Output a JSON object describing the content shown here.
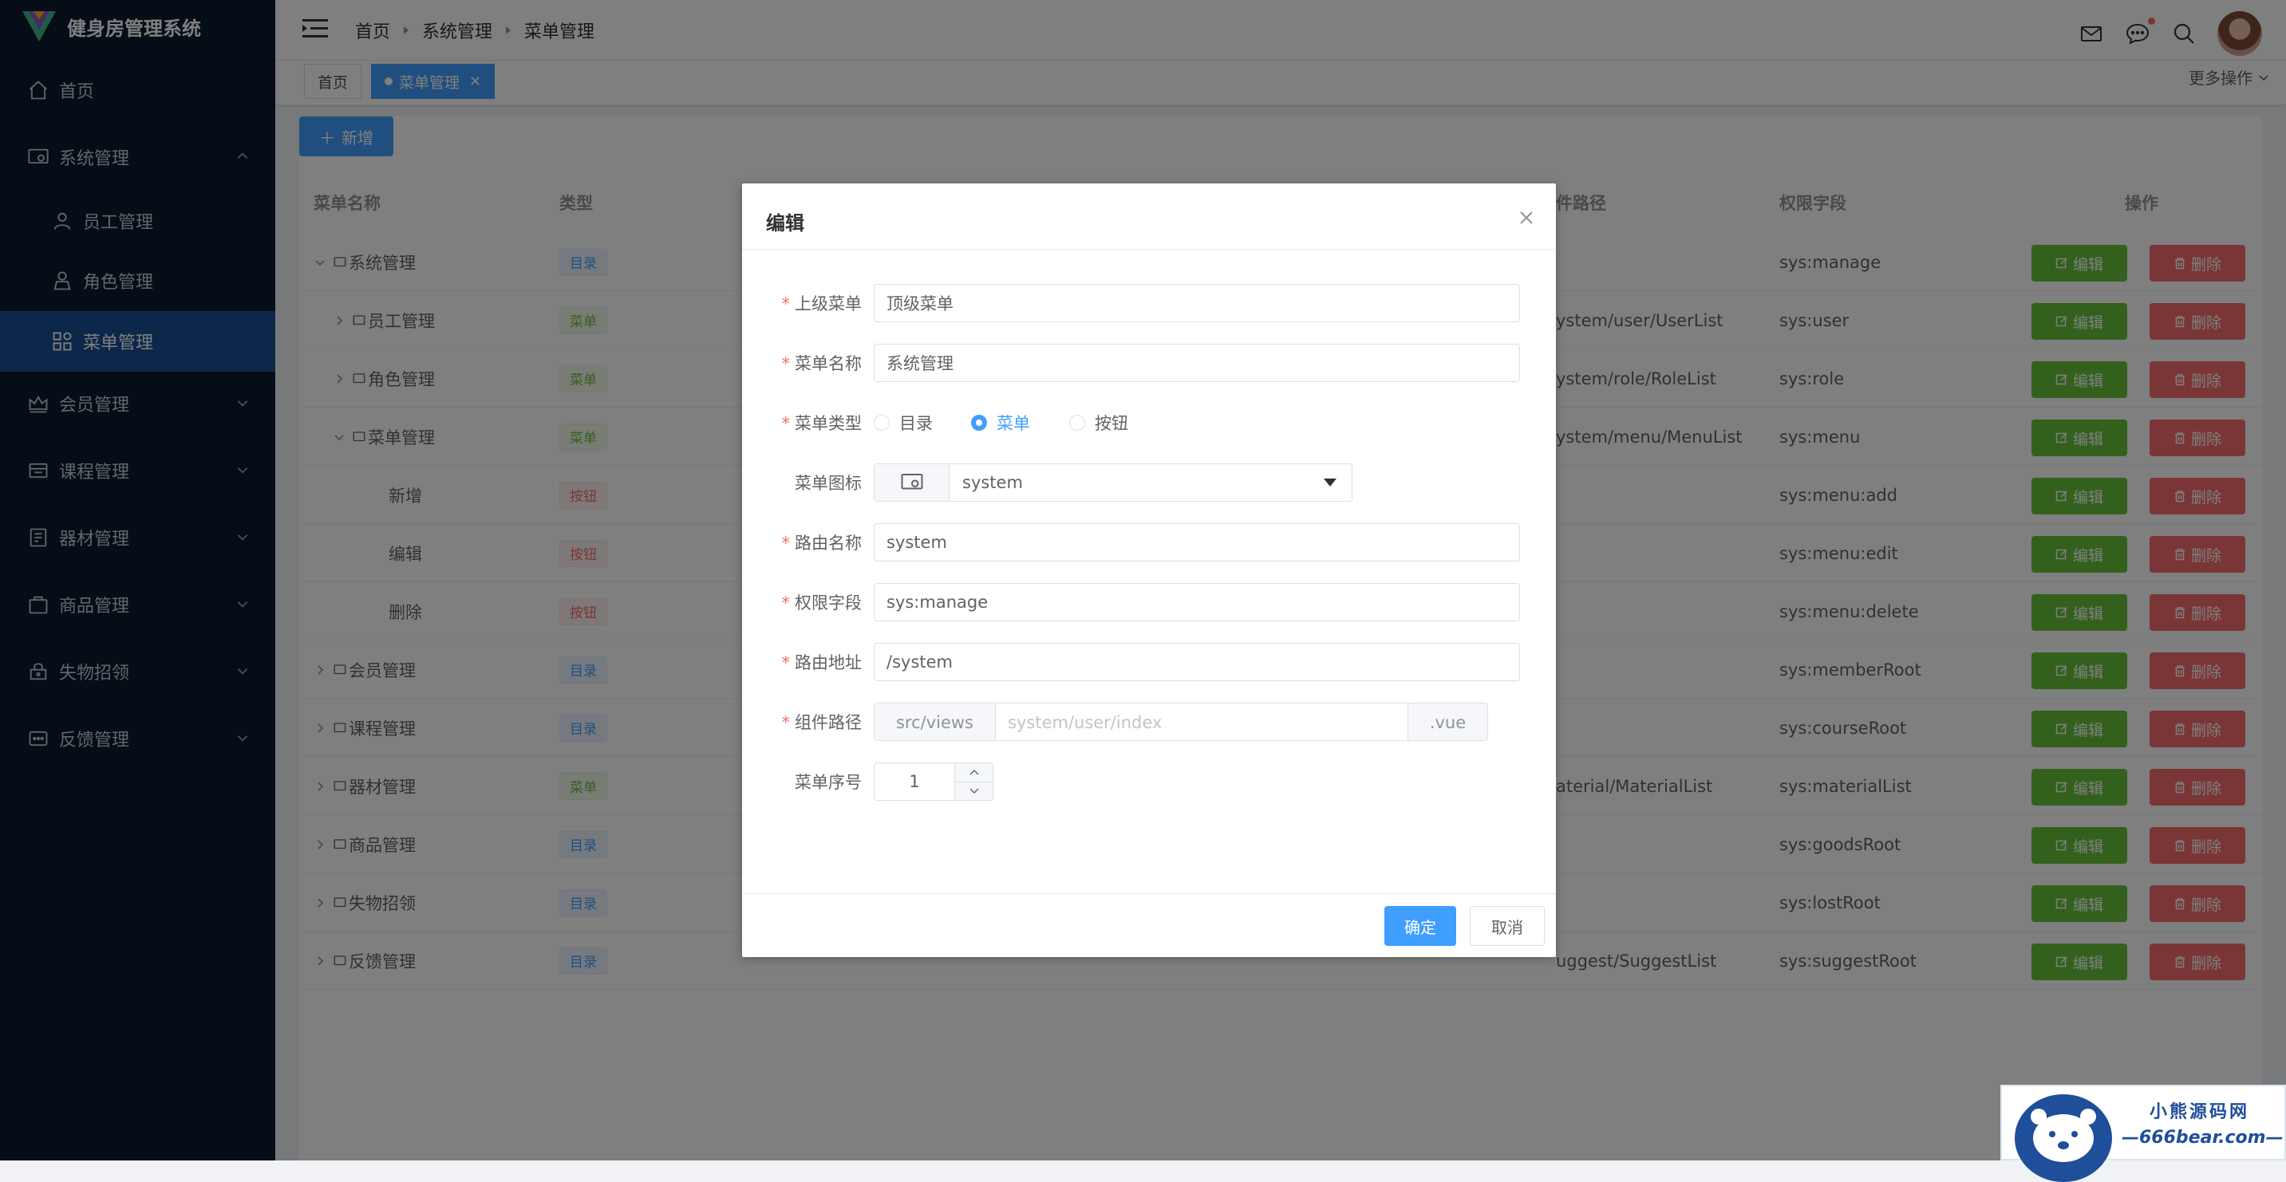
{
  "app": {
    "title": "健身房管理系统"
  },
  "sidebar": {
    "items": [
      {
        "label": "首页",
        "icon": "home-icon"
      },
      {
        "label": "系统管理",
        "icon": "system-icon",
        "expanded": true
      },
      {
        "label": "员工管理",
        "icon": "user-icon"
      },
      {
        "label": "角色管理",
        "icon": "role-icon"
      },
      {
        "label": "菜单管理",
        "icon": "grid-icon",
        "active": true
      },
      {
        "label": "会员管理",
        "icon": "crown-icon"
      },
      {
        "label": "课程管理",
        "icon": "course-icon"
      },
      {
        "label": "器材管理",
        "icon": "equipment-icon"
      },
      {
        "label": "商品管理",
        "icon": "goods-icon"
      },
      {
        "label": "失物招领",
        "icon": "lost-icon"
      },
      {
        "label": "反馈管理",
        "icon": "feedback-icon"
      }
    ]
  },
  "header": {
    "breadcrumb": [
      "首页",
      "系统管理",
      "菜单管理"
    ]
  },
  "tags": {
    "home": "首页",
    "active": "菜单管理",
    "more": "更多操作"
  },
  "toolbar": {
    "add_label": "新增"
  },
  "table": {
    "headers": {
      "name": "菜单名称",
      "type": "类型",
      "path": "件路径",
      "perm": "权限字段",
      "ops": "操作"
    },
    "edit_label": "编辑",
    "delete_label": "删除",
    "rows": [
      {
        "name": "系统管理",
        "type": "目录",
        "path": "",
        "perm": "sys:manage"
      },
      {
        "name": "员工管理",
        "type": "菜单",
        "path": "ystem/user/UserList",
        "perm": "sys:user"
      },
      {
        "name": "角色管理",
        "type": "菜单",
        "path": "ystem/role/RoleList",
        "perm": "sys:role"
      },
      {
        "name": "菜单管理",
        "type": "菜单",
        "path": "ystem/menu/MenuList",
        "perm": "sys:menu"
      },
      {
        "name": "新增",
        "type": "按钮",
        "path": "",
        "perm": "sys:menu:add"
      },
      {
        "name": "编辑",
        "type": "按钮",
        "path": "",
        "perm": "sys:menu:edit"
      },
      {
        "name": "删除",
        "type": "按钮",
        "path": "",
        "perm": "sys:menu:delete"
      },
      {
        "name": "会员管理",
        "type": "目录",
        "path": "",
        "perm": "sys:memberRoot"
      },
      {
        "name": "课程管理",
        "type": "目录",
        "path": "",
        "perm": "sys:courseRoot"
      },
      {
        "name": "器材管理",
        "type": "菜单",
        "path": "aterial/MaterialList",
        "perm": "sys:materialList"
      },
      {
        "name": "商品管理",
        "type": "目录",
        "path": "",
        "perm": "sys:goodsRoot"
      },
      {
        "name": "失物招领",
        "type": "目录",
        "path": "",
        "perm": "sys:lostRoot"
      },
      {
        "name": "反馈管理",
        "type": "目录",
        "path": "uggest/SuggestList",
        "perm": "sys:suggestRoot"
      }
    ]
  },
  "dialog": {
    "title": "编辑",
    "parent_label": "上级菜单",
    "parent_value": "顶级菜单",
    "name_label": "菜单名称",
    "name_value": "系统管理",
    "type_label": "菜单类型",
    "type_options": [
      "目录",
      "菜单",
      "按钮"
    ],
    "type_selected": "菜单",
    "icon_label": "菜单图标",
    "icon_value": "system",
    "route_name_label": "路由名称",
    "route_name_value": "system",
    "perm_label": "权限字段",
    "perm_value": "sys:manage",
    "route_path_label": "路由地址",
    "route_path_value": "/system",
    "comp_label": "组件路径",
    "comp_prefix": "src/views",
    "comp_placeholder": "system/user/index",
    "comp_suffix": ".vue",
    "order_label": "菜单序号",
    "order_value": "1",
    "ok_label": "确定",
    "cancel_label": "取消"
  },
  "watermark": {
    "line1": "小熊源码网",
    "line2": "—666bear.com—"
  },
  "colors": {
    "primary": "#409eff",
    "sidebar_bg": "#0b1a2f",
    "success": "#67c23a",
    "danger": "#f56c6c"
  }
}
